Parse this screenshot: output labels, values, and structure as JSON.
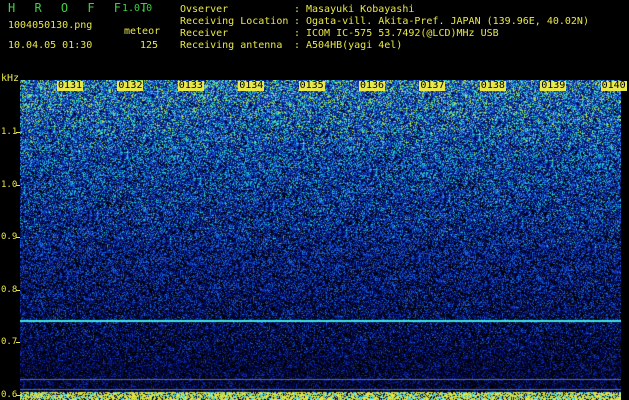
{
  "app": {
    "title": "H R O F F T",
    "version": "1.0.0",
    "filename": "1004050130.png",
    "mode": "meteor",
    "datetime": "10.04.05 01:30",
    "count": "125"
  },
  "header": {
    "rows": [
      {
        "label": "Ovserver",
        "value": "Masayuki Kobayashi"
      },
      {
        "label": "Receiving Location",
        "value": "Ogata-vill. Akita-Pref. JAPAN (139.96E, 40.02N)"
      },
      {
        "label": "Receiver",
        "value": "ICOM IC-575 53.7492(@LCD)MHz USB"
      },
      {
        "label": "Receiving antenna",
        "value": "A504HB(yagi 4el)"
      }
    ],
    "colon": ":"
  },
  "axis": {
    "y_unit": "kHz",
    "y_ticks": [
      {
        "label": "1.1",
        "value": 1.1
      },
      {
        "label": "1.0",
        "value": 1.0
      },
      {
        "label": "0.9",
        "value": 0.9
      },
      {
        "label": "0.8",
        "value": 0.8
      },
      {
        "label": "0.7",
        "value": 0.7
      },
      {
        "label": "0.6",
        "value": 0.6
      }
    ],
    "x_ticks": [
      "0131",
      "0132",
      "0133",
      "0134",
      "0135",
      "0136",
      "0137",
      "0138",
      "0139",
      "0140"
    ]
  },
  "spectrogram": {
    "freq_top": 1.2,
    "freq_bottom": 0.59,
    "signal_line_khz": 0.74,
    "colors": {
      "background": "#000000",
      "low": "#0a1a8a",
      "mid": "#1a5fd8",
      "high": "#2fd8c8",
      "peak": "#c8e84a",
      "signal": "#3fe8e8",
      "label": "#e8e84a",
      "title_green": "#3fd13f"
    }
  }
}
